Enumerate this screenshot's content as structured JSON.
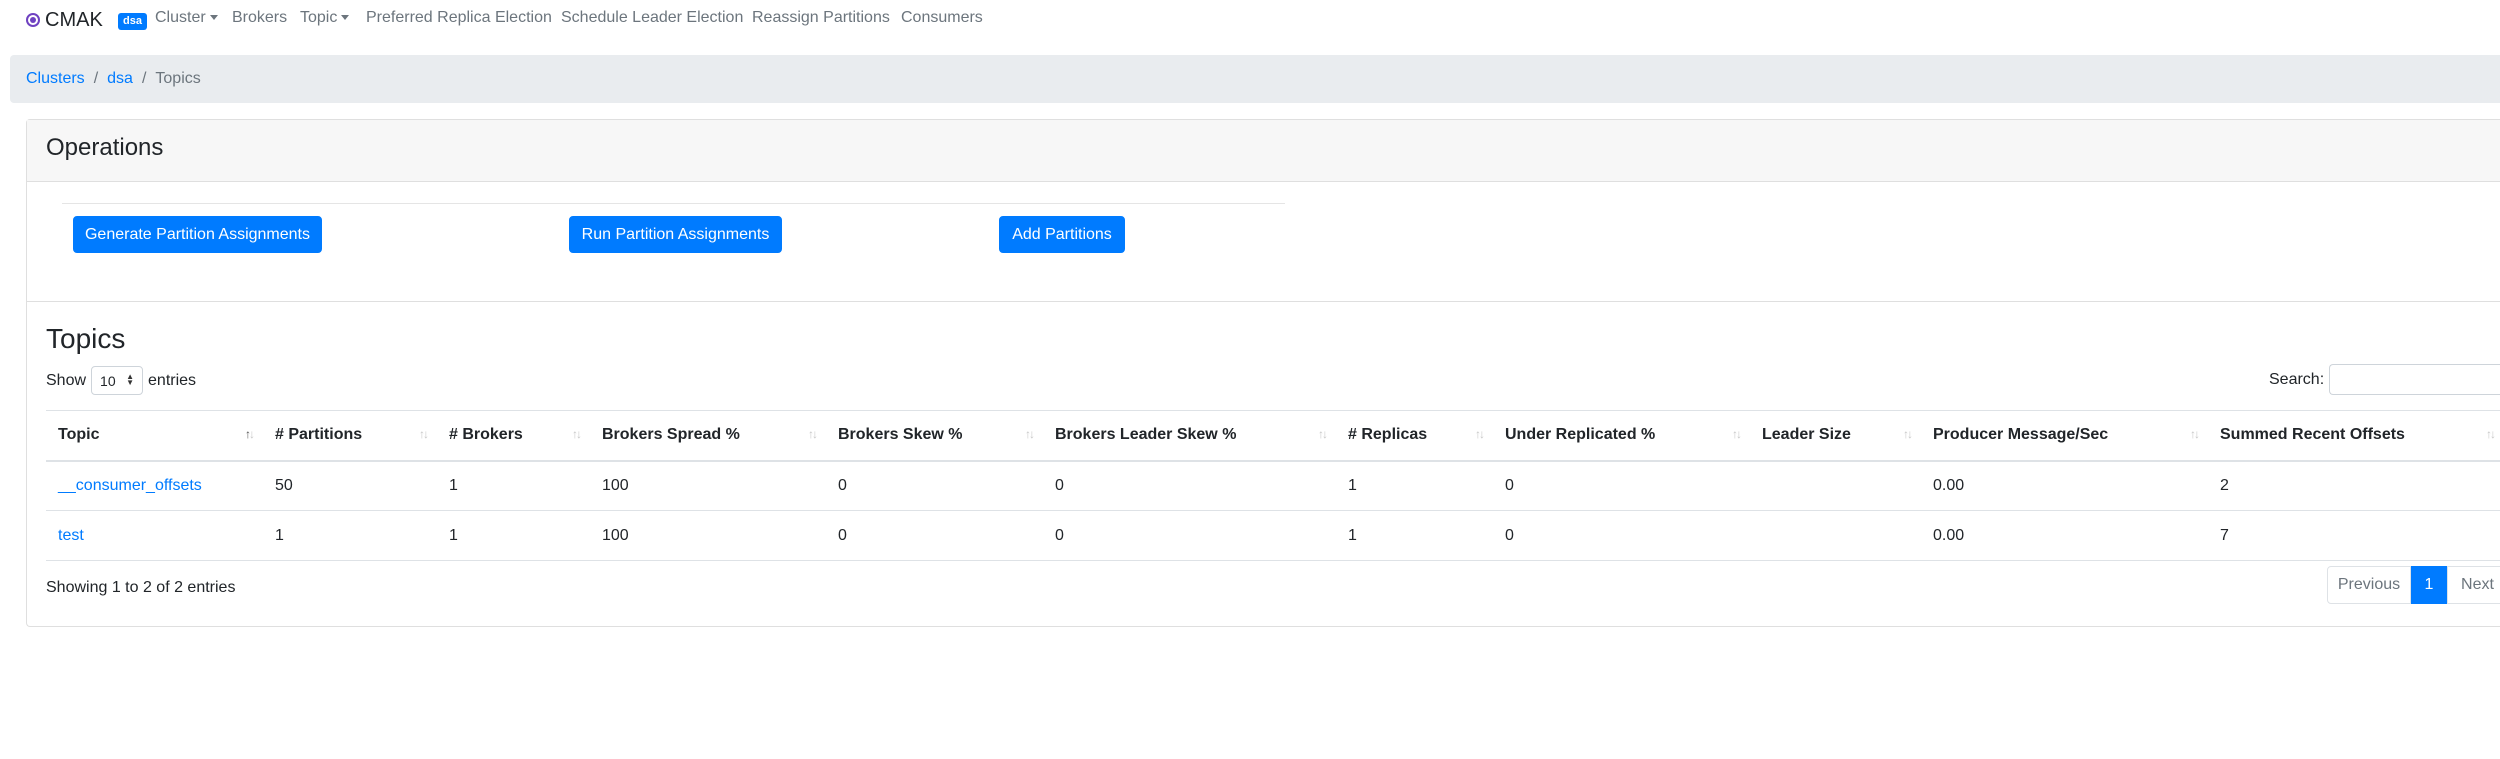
{
  "navbar": {
    "brand": "CMAK",
    "cluster_badge": "dsa",
    "items": [
      "Cluster",
      "Brokers",
      "Topic",
      "Preferred Replica Election",
      "Schedule Leader Election",
      "Reassign Partitions",
      "Consumers"
    ]
  },
  "breadcrumb": {
    "items": [
      "Clusters",
      "dsa",
      "Topics"
    ],
    "separator": "/"
  },
  "operations": {
    "title": "Operations",
    "buttons": [
      "Generate Partition Assignments",
      "Run Partition Assignments",
      "Add Partitions"
    ]
  },
  "topics": {
    "title": "Topics",
    "show_label": "Show",
    "entries_label": "entries",
    "page_length": "10",
    "search_label": "Search:",
    "search_value": "",
    "columns": [
      "Topic",
      "# Partitions",
      "# Brokers",
      "Brokers Spread %",
      "Brokers Skew %",
      "Brokers Leader Skew %",
      "# Replicas",
      "Under Replicated %",
      "Leader Size",
      "Producer Message/Sec",
      "Summed Recent Offsets"
    ],
    "sorted_column": "Topic",
    "rows": [
      [
        "__consumer_offsets",
        "50",
        "1",
        "100",
        "0",
        "0",
        "1",
        "0",
        "",
        "0.00",
        "2"
      ],
      [
        "test",
        "1",
        "1",
        "100",
        "0",
        "0",
        "1",
        "0",
        "",
        "0.00",
        "7"
      ]
    ],
    "info": "Showing 1 to 2 of 2 entries",
    "pagination": {
      "previous": "Previous",
      "current": "1",
      "next": "Next"
    }
  },
  "colors": {
    "primary": "#007bff",
    "nav_text": "#6c757d",
    "breadcrumb_bg": "#e9ecef",
    "card_header_bg": "#f7f7f7"
  }
}
